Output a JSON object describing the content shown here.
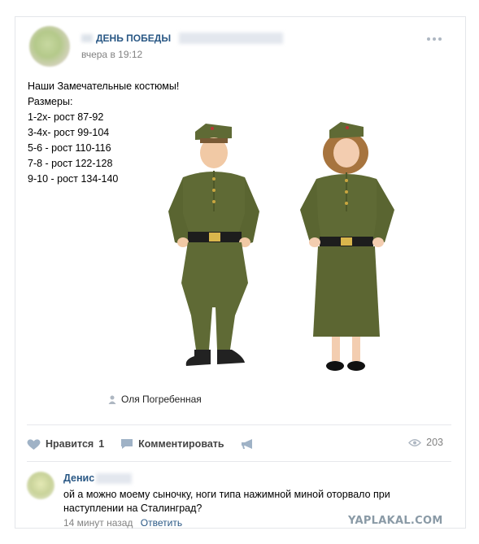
{
  "post": {
    "author": "ДЕНЬ ПОБЕДЫ",
    "time": "вчера в 19:12",
    "text_lines": [
      "Наши Замечательные костюмы!",
      "Размеры:",
      "1-2х- рост 87-92",
      "3-4х- рост 99-104",
      "5-6 - рост 110-116",
      "7-8 - рост 122-128",
      "9-10 - рост 134-140"
    ],
    "tagged_person": "Оля Погребенная",
    "photo_icon": "person-icon"
  },
  "actions": {
    "like_label": "Нравится",
    "like_count": "1",
    "comment_label": "Комментировать",
    "share_icon": "megaphone-icon",
    "views_icon": "eye-icon",
    "views_count": "203"
  },
  "comment": {
    "author": "Денис",
    "text": "ой а можно моему сыночку, ноги типа нажимной миной оторвало при наступлении на Сталинград?",
    "time": "14 минут назад",
    "reply_label": "Ответить"
  },
  "watermark": "YAPLAKAL.COM",
  "colors": {
    "link": "#2a5885",
    "meta": "#828282",
    "uniform": "#5f6a35",
    "uniform_dark": "#4e5829"
  }
}
